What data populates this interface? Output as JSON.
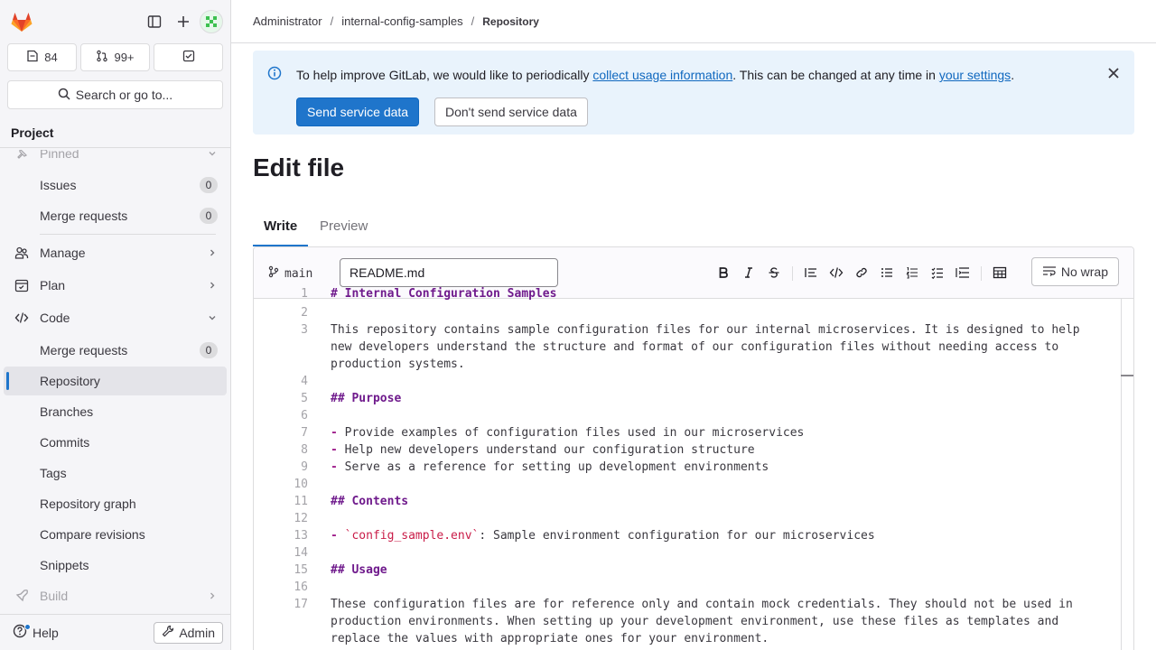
{
  "sidebar": {
    "counts": {
      "issues": "84",
      "merge_requests": "99+"
    },
    "search_label": "Search or go to...",
    "section_title": "Project",
    "pinned_label": "Pinned",
    "pinned_items": [
      {
        "label": "Issues",
        "count": "0"
      },
      {
        "label": "Merge requests",
        "count": "0"
      }
    ],
    "groups": {
      "manage": "Manage",
      "plan": "Plan",
      "code": "Code",
      "build": "Build"
    },
    "code_items": [
      {
        "label": "Merge requests",
        "count": "0"
      },
      {
        "label": "Repository"
      },
      {
        "label": "Branches"
      },
      {
        "label": "Commits"
      },
      {
        "label": "Tags"
      },
      {
        "label": "Repository graph"
      },
      {
        "label": "Compare revisions"
      },
      {
        "label": "Snippets"
      }
    ],
    "help_label": "Help",
    "admin_label": "Admin"
  },
  "breadcrumb": [
    "Administrator",
    "internal-config-samples",
    "Repository"
  ],
  "alert": {
    "text_before": "To help improve GitLab, we would like to periodically ",
    "link1": "collect usage information",
    "text_middle": ". This can be changed at any time in ",
    "link2": "your settings",
    "text_after": ".",
    "primary_button": "Send service data",
    "secondary_button": "Don't send service data"
  },
  "page_title": "Edit file",
  "tabs": [
    "Write",
    "Preview"
  ],
  "editor": {
    "branch": "main",
    "filename": "README.md",
    "nowrap_label": "No wrap",
    "partial_first_line": "# Internal Configuration Samples",
    "lines": [
      {
        "n": "2",
        "segments": []
      },
      {
        "n": "3",
        "segments": [
          {
            "t": "This repository contains sample configuration files for our internal microservices. It is designed to help\nnew developers understand the structure and format of our configuration files without needing access to\nproduction systems."
          }
        ]
      },
      {
        "n": "4",
        "segments": []
      },
      {
        "n": "5",
        "segments": [
          {
            "t": "## Purpose",
            "c": "h"
          }
        ]
      },
      {
        "n": "6",
        "segments": []
      },
      {
        "n": "7",
        "segments": [
          {
            "t": "-",
            "c": "dash"
          },
          {
            "t": " Provide examples of configuration files used in our microservices"
          }
        ]
      },
      {
        "n": "8",
        "segments": [
          {
            "t": "-",
            "c": "dash"
          },
          {
            "t": " Help new developers understand our configuration structure"
          }
        ]
      },
      {
        "n": "9",
        "segments": [
          {
            "t": "-",
            "c": "dash"
          },
          {
            "t": " Serve as a reference for setting up development environments"
          }
        ]
      },
      {
        "n": "10",
        "segments": []
      },
      {
        "n": "11",
        "segments": [
          {
            "t": "## Contents",
            "c": "h"
          }
        ]
      },
      {
        "n": "12",
        "segments": []
      },
      {
        "n": "13",
        "segments": [
          {
            "t": "-",
            "c": "dash"
          },
          {
            "t": " "
          },
          {
            "t": "`config_sample.env`",
            "c": "tick"
          },
          {
            "t": ": Sample environment configuration for our microservices"
          }
        ]
      },
      {
        "n": "14",
        "segments": []
      },
      {
        "n": "15",
        "segments": [
          {
            "t": "## Usage",
            "c": "h"
          }
        ]
      },
      {
        "n": "16",
        "segments": []
      },
      {
        "n": "17",
        "segments": [
          {
            "t": "These configuration files are for reference only and contain mock credentials. They should not be used in\nproduction environments. When setting up your development environment, use these files as templates and\nreplace the values with appropriate ones for your environment."
          }
        ]
      }
    ]
  },
  "colors": {
    "accent": "#1f75cb",
    "alert_bg": "#e9f3fc",
    "heading": "#6f1a8c",
    "code_tick": "#c91c48"
  }
}
